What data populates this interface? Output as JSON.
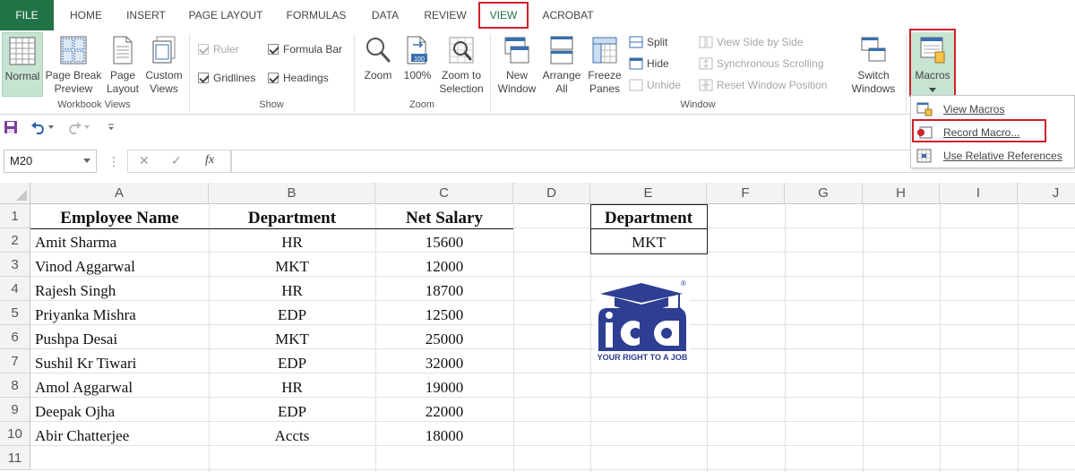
{
  "tabs": [
    "FILE",
    "HOME",
    "INSERT",
    "PAGE LAYOUT",
    "FORMULAS",
    "DATA",
    "REVIEW",
    "VIEW",
    "ACROBAT"
  ],
  "active_tab": "VIEW",
  "accent_color": "#217346",
  "highlight_color": "#d0202a",
  "ribbon": {
    "workbook_views": {
      "label": "Workbook Views",
      "normal": "Normal",
      "page_break_1": "Page Break",
      "page_break_2": "Preview",
      "page_layout_1": "Page",
      "page_layout_2": "Layout",
      "custom_1": "Custom",
      "custom_2": "Views"
    },
    "show": {
      "label": "Show",
      "ruler": "Ruler",
      "formula_bar": "Formula Bar",
      "gridlines": "Gridlines",
      "headings": "Headings"
    },
    "zoom": {
      "label": "Zoom",
      "zoom": "Zoom",
      "hundred": "100%",
      "zoom_sel_1": "Zoom to",
      "zoom_sel_2": "Selection"
    },
    "window": {
      "label": "Window",
      "new_1": "New",
      "new_2": "Window",
      "arrange_1": "Arrange",
      "arrange_2": "All",
      "freeze_1": "Freeze",
      "freeze_2": "Panes",
      "split": "Split",
      "hide": "Hide",
      "unhide": "Unhide",
      "side_by_side": "View Side by Side",
      "sync_scroll": "Synchronous Scrolling",
      "reset_pos": "Reset Window Position",
      "switch_1": "Switch",
      "switch_2": "Windows"
    },
    "macros": {
      "label": "Macros"
    }
  },
  "macro_menu": [
    "View Macros",
    "Record Macro...",
    "Use Relative References"
  ],
  "name_box": "M20",
  "formula_icons": {
    "cancel": "✕",
    "enter": "✓",
    "fx": "fx"
  },
  "columns": [
    "A",
    "B",
    "C",
    "D",
    "E",
    "F",
    "G",
    "H",
    "I",
    "J"
  ],
  "rows": [
    "1",
    "2",
    "3",
    "4",
    "5",
    "6",
    "7",
    "8",
    "9",
    "10",
    "11"
  ],
  "table": {
    "headers": [
      "Employee Name",
      "Department",
      "Net Salary"
    ],
    "rows": [
      [
        "Amit Sharma",
        "HR",
        "15600"
      ],
      [
        "Vinod Aggarwal",
        "MKT",
        "12000"
      ],
      [
        "Rajesh Singh",
        "HR",
        "18700"
      ],
      [
        "Priyanka Mishra",
        "EDP",
        "12500"
      ],
      [
        "Pushpa Desai",
        "MKT",
        "25000"
      ],
      [
        "Sushil Kr Tiwari",
        "EDP",
        "32000"
      ],
      [
        "Amol Aggarwal",
        "HR",
        "19000"
      ],
      [
        "Deepak Ojha",
        "EDP",
        "22000"
      ],
      [
        "Abir Chatterjee",
        "Accts",
        "18000"
      ]
    ]
  },
  "criteria": {
    "header": "Department",
    "value": "MKT"
  },
  "logo": {
    "text": "ica",
    "tagline": "YOUR RIGHT TO A JOB",
    "mark": "®"
  }
}
